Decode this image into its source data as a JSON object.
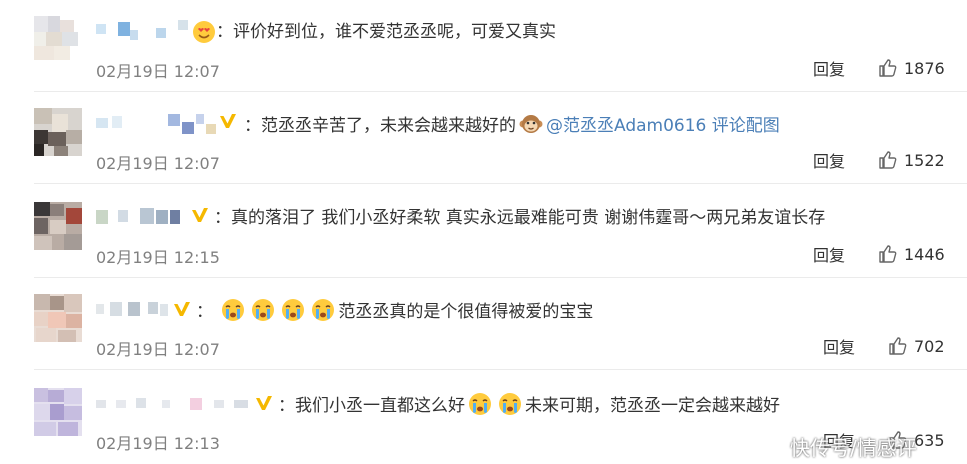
{
  "comments": [
    {
      "separator": "：",
      "text": "评价好到位，谁不爱范丞丞呢，可爱又真实",
      "mention": "",
      "link": "",
      "time": "02月19日 12:07",
      "reply_label": "回复",
      "likes": "1876"
    },
    {
      "separator": "：",
      "text": "范丞丞辛苦了，未来会越来越好的",
      "mention": "@范丞丞Adam0616",
      "link": "评论配图",
      "time": "02月19日 12:07",
      "reply_label": "回复",
      "likes": "1522"
    },
    {
      "separator": "：",
      "text": "真的落泪了 我们小丞好柔软 真实永远最难能可贵 谢谢伟霆哥～两兄弟友谊长存",
      "mention": "",
      "link": "",
      "time": "02月19日 12:15",
      "reply_label": "回复",
      "likes": "1446"
    },
    {
      "separator": "：",
      "text": "范丞丞真的是个很值得被爱的宝宝",
      "mention": "",
      "link": "",
      "time": "02月19日 12:07",
      "reply_label": "回复",
      "likes": "702"
    },
    {
      "separator": "：",
      "text_before": "我们小丞一直都这么好",
      "text_after": "未来可期，范丞丞一定会越来越好",
      "mention": "",
      "link": "",
      "time": "02月19日 12:13",
      "reply_label": "回复",
      "likes": "635"
    }
  ],
  "watermark": "快传号/情感评",
  "colors": {
    "text": "#333333",
    "timestamp": "#808080",
    "mention": "#4b7fb7",
    "vip_badge": "#f5b800",
    "divider": "#ebebeb"
  },
  "icons": {
    "like": "thumbs-up-outline-icon",
    "badge": "v-verified-badge-icon",
    "emoji_cry": "crying-face-emoji-icon",
    "emoji_monkey": "monkey-face-emoji-icon",
    "emoji_heart_eyes": "heart-eyes-emoji-icon"
  }
}
